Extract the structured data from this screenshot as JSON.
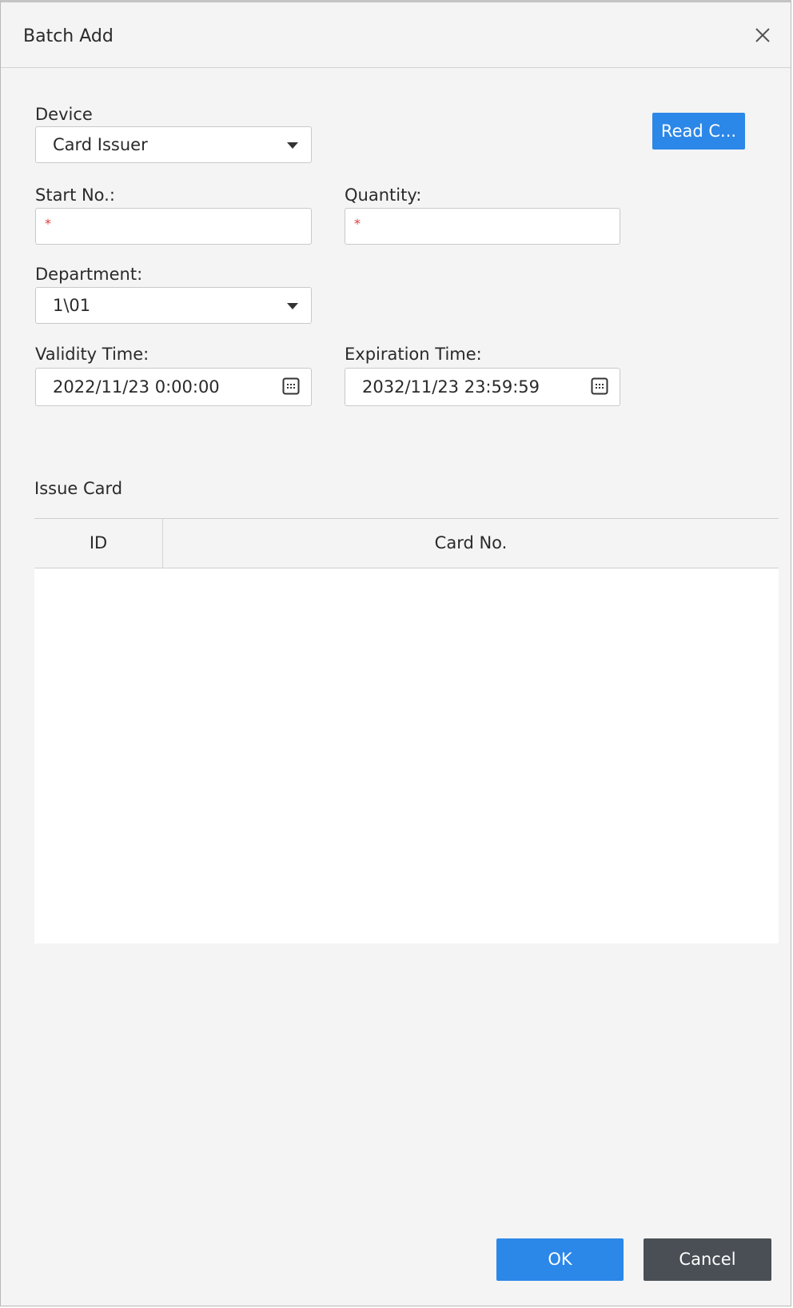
{
  "dialog": {
    "title": "Batch Add"
  },
  "form": {
    "device_label": "Device",
    "device_value": "Card Issuer",
    "read_card_button": "Read C...",
    "start_no_label": "Start No.:",
    "start_no_required": "*",
    "quantity_label": "Quantity:",
    "quantity_required": "*",
    "department_label": "Department:",
    "department_value": "1\\01",
    "validity_label": "Validity Time:",
    "validity_value": "2022/11/23 0:00:00",
    "expiration_label": "Expiration Time:",
    "expiration_value": "2032/11/23 23:59:59"
  },
  "issue_card": {
    "title": "Issue Card",
    "columns": [
      "ID",
      "Card No."
    ],
    "rows": []
  },
  "footer": {
    "ok_label": "OK",
    "cancel_label": "Cancel"
  },
  "icons": {
    "close": "close-icon",
    "dropdown": "chevron-down-icon",
    "calendar": "calendar-icon"
  },
  "colors": {
    "primary": "#2b87e8",
    "secondary": "#4a4f55",
    "required": "#e23b3b",
    "background": "#f4f4f4"
  }
}
